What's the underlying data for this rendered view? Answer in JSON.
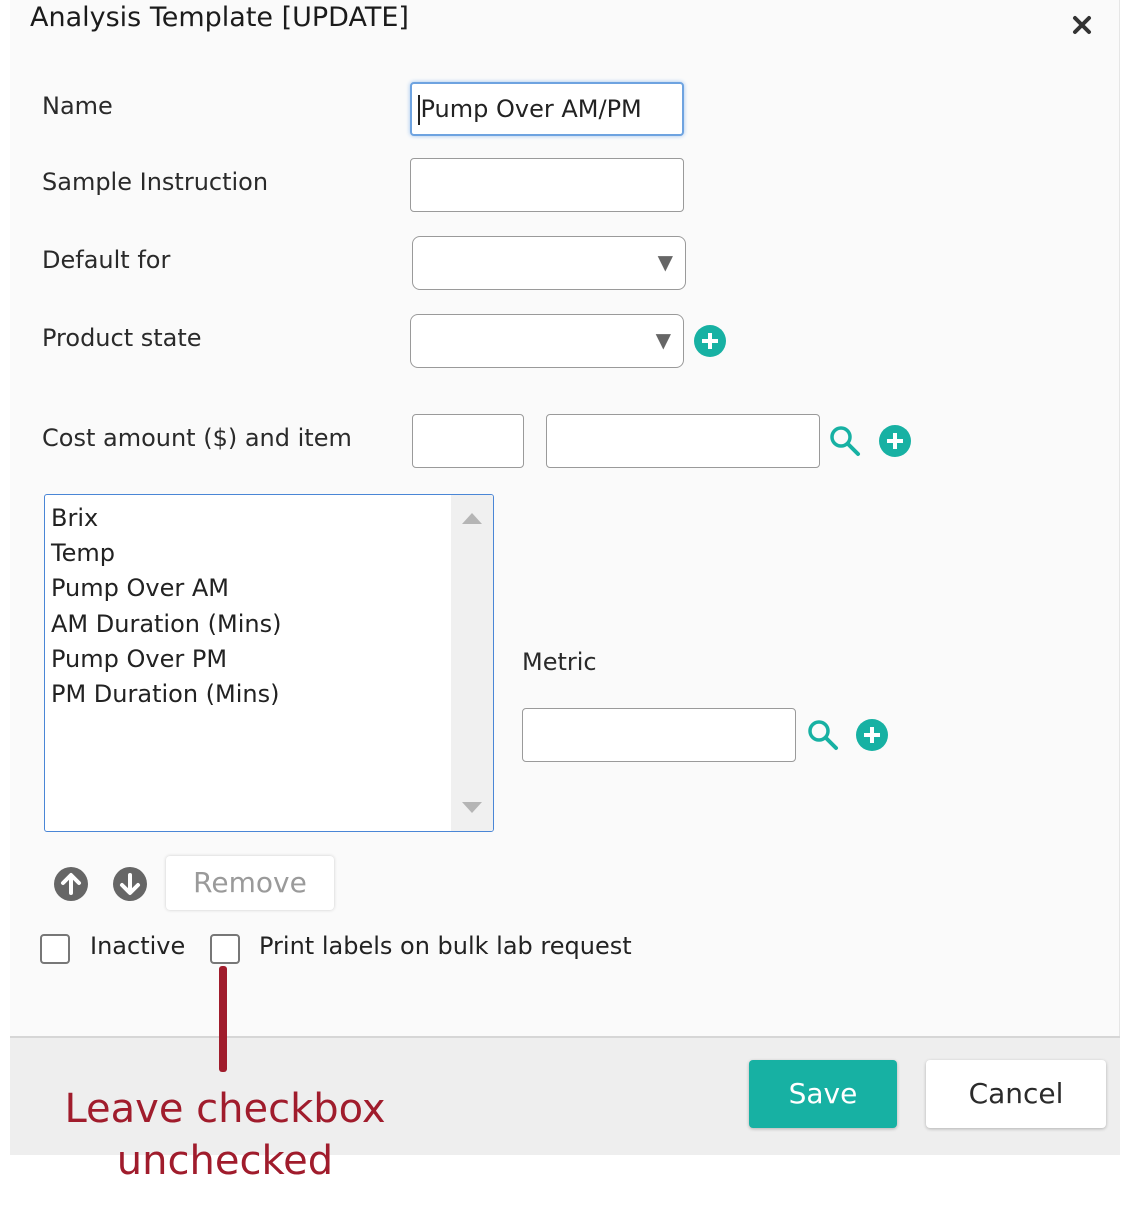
{
  "dialog": {
    "title": "Analysis Template [UPDATE]",
    "close_icon": "close-icon"
  },
  "form": {
    "name_label": "Name",
    "name_value": "Pump Over AM/PM",
    "sample_instruction_label": "Sample Instruction",
    "sample_instruction_value": "",
    "default_for_label": "Default for",
    "default_for_value": "",
    "product_state_label": "Product state",
    "product_state_value": "",
    "cost_label": "Cost amount ($) and item",
    "cost_amount_value": "",
    "cost_item_value": ""
  },
  "metrics_list": {
    "items": [
      "Brix",
      "Temp",
      "Pump Over AM",
      "AM Duration (Mins)",
      "Pump Over PM",
      "PM Duration (Mins)"
    ]
  },
  "metric": {
    "label": "Metric",
    "value": ""
  },
  "list_controls": {
    "remove_label": "Remove"
  },
  "checkboxes": {
    "inactive_label": "Inactive",
    "inactive_checked": false,
    "print_labels_label": "Print labels on bulk lab request",
    "print_labels_checked": false
  },
  "footer": {
    "save_label": "Save",
    "cancel_label": "Cancel"
  },
  "annotation": {
    "text": "Leave checkbox unchecked"
  },
  "colors": {
    "accent": "#17b1a3",
    "annotation": "#a01c2c"
  }
}
